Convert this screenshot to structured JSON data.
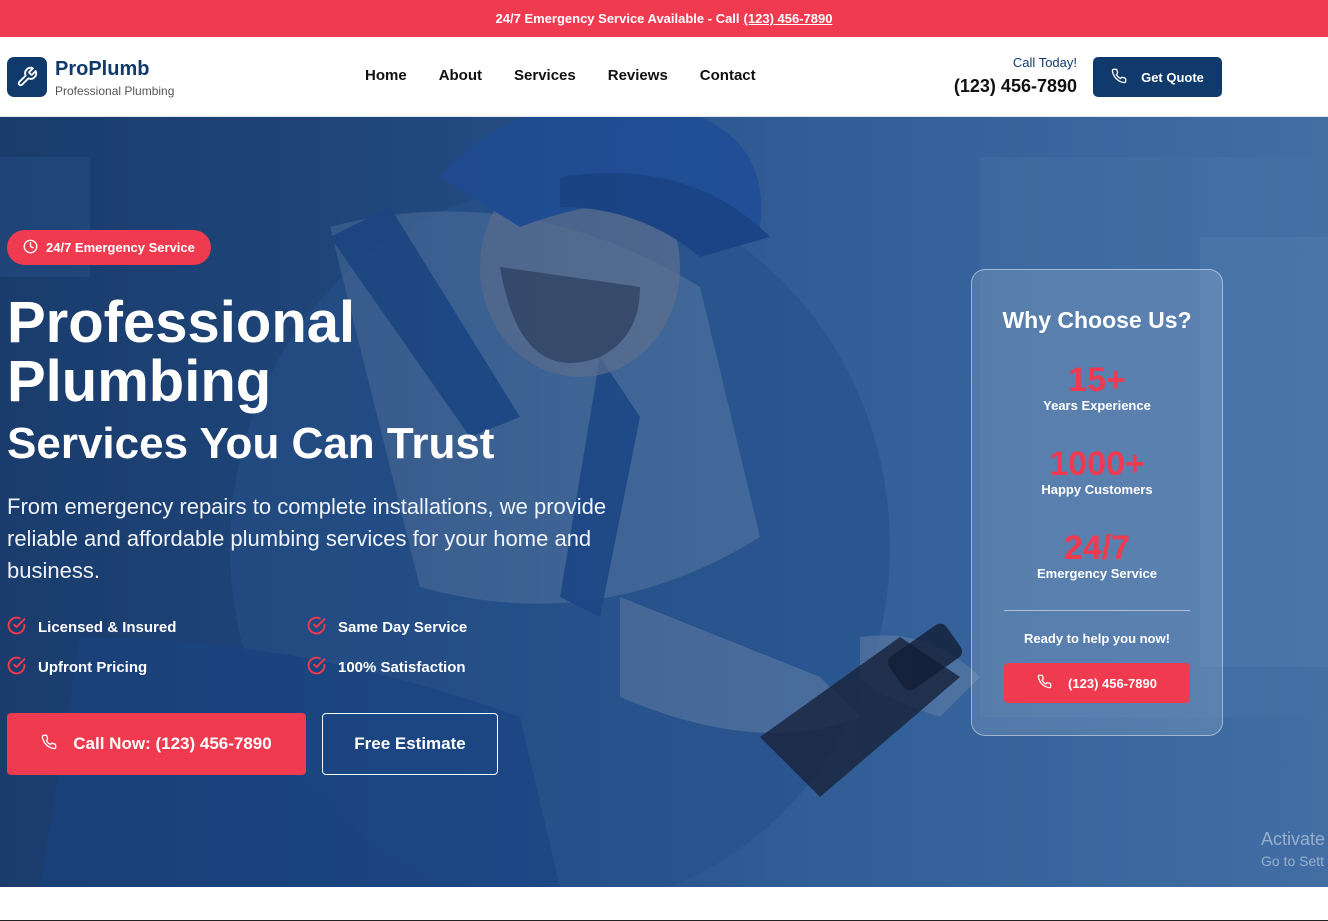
{
  "topbar": {
    "text": "24/7 Emergency Service Available - Call",
    "phone": "(123) 456-7890"
  },
  "header": {
    "brand": "ProPlumb",
    "tagline": "Professional Plumbing",
    "nav": [
      "Home",
      "About",
      "Services",
      "Reviews",
      "Contact"
    ],
    "call_today": "Call Today!",
    "phone": "(123) 456-7890",
    "quote_button": "Get Quote"
  },
  "hero": {
    "badge": "24/7 Emergency Service",
    "title_line1": "Professional",
    "title_line2": "Plumbing",
    "subtitle": "Services You Can Trust",
    "lead": "From emergency repairs to complete installations, we provide reliable and affordable plumbing services for your home and business.",
    "features": [
      "Licensed & Insured",
      "Same Day Service",
      "Upfront Pricing",
      "100% Satisfaction"
    ],
    "call_button": "Call Now: (123) 456-7890",
    "estimate_button": "Free Estimate"
  },
  "why_card": {
    "title": "Why Choose Us?",
    "stats": [
      {
        "value": "15+",
        "label": "Years Experience"
      },
      {
        "value": "1000+",
        "label": "Happy Customers"
      },
      {
        "value": "24/7",
        "label": "Emergency Service"
      }
    ],
    "ready_text": "Ready to help you now!",
    "button": "(123) 456-7890"
  },
  "watermark": {
    "line1": "Activate",
    "line2": "Go to Sett"
  },
  "colors": {
    "accent": "#ef3a4f",
    "navy": "#0f3a6b",
    "hero_blue": "#2a5690"
  }
}
